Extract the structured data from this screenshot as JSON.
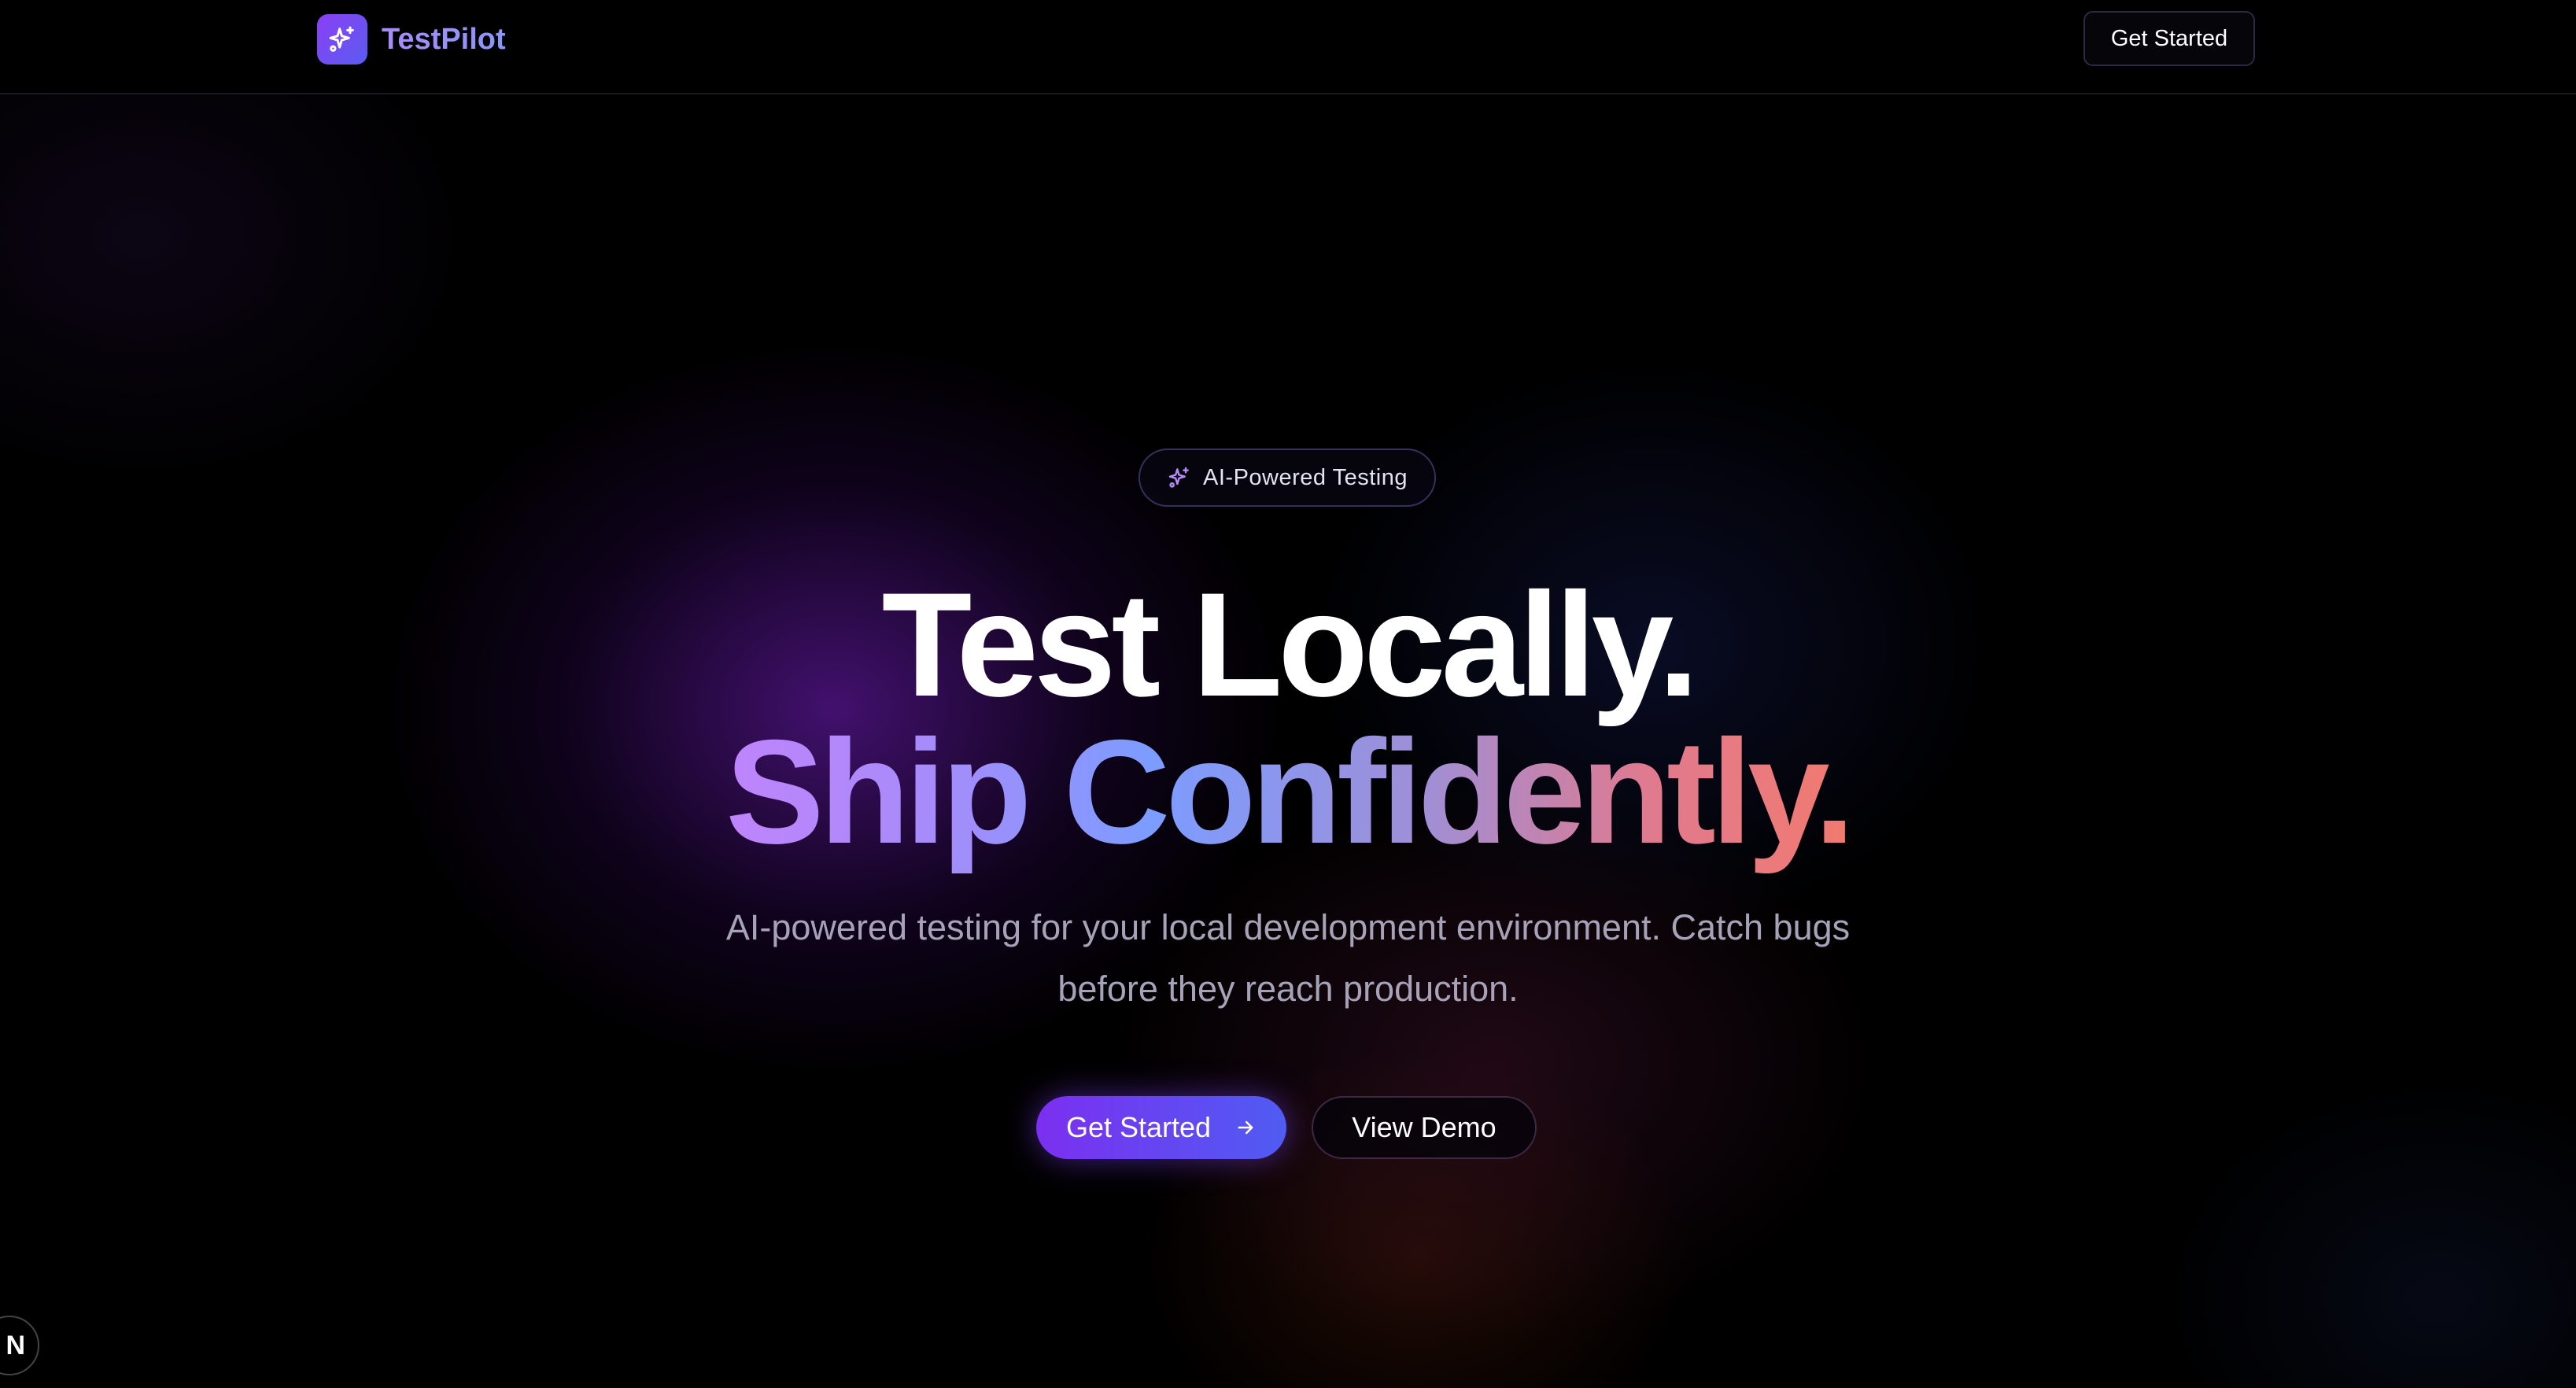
{
  "header": {
    "brand_name": "TestPilot",
    "brand_icon": "sparkles-icon",
    "cta_label": "Get Started"
  },
  "hero": {
    "badge_icon": "sparkles-icon",
    "badge_text": "AI-Powered Testing",
    "headline_line1": "Test Locally.",
    "headline_line2": "Ship Confidently.",
    "subtitle": "AI-powered testing for your local development environment. Catch bugs before they reach production.",
    "primary_button_label": "Get Started",
    "primary_button_icon": "arrow-right-icon",
    "secondary_button_label": "View Demo"
  },
  "dev_indicator": {
    "label": "N"
  },
  "colors": {
    "background": "#000000",
    "brand_gradient_start": "#8b3ff5",
    "brand_gradient_end": "#5b5cf0",
    "headline_gradient": [
      "#c084fc",
      "#7c9cff",
      "#f27a6f"
    ],
    "subtitle_text": "#a6a3b8"
  }
}
